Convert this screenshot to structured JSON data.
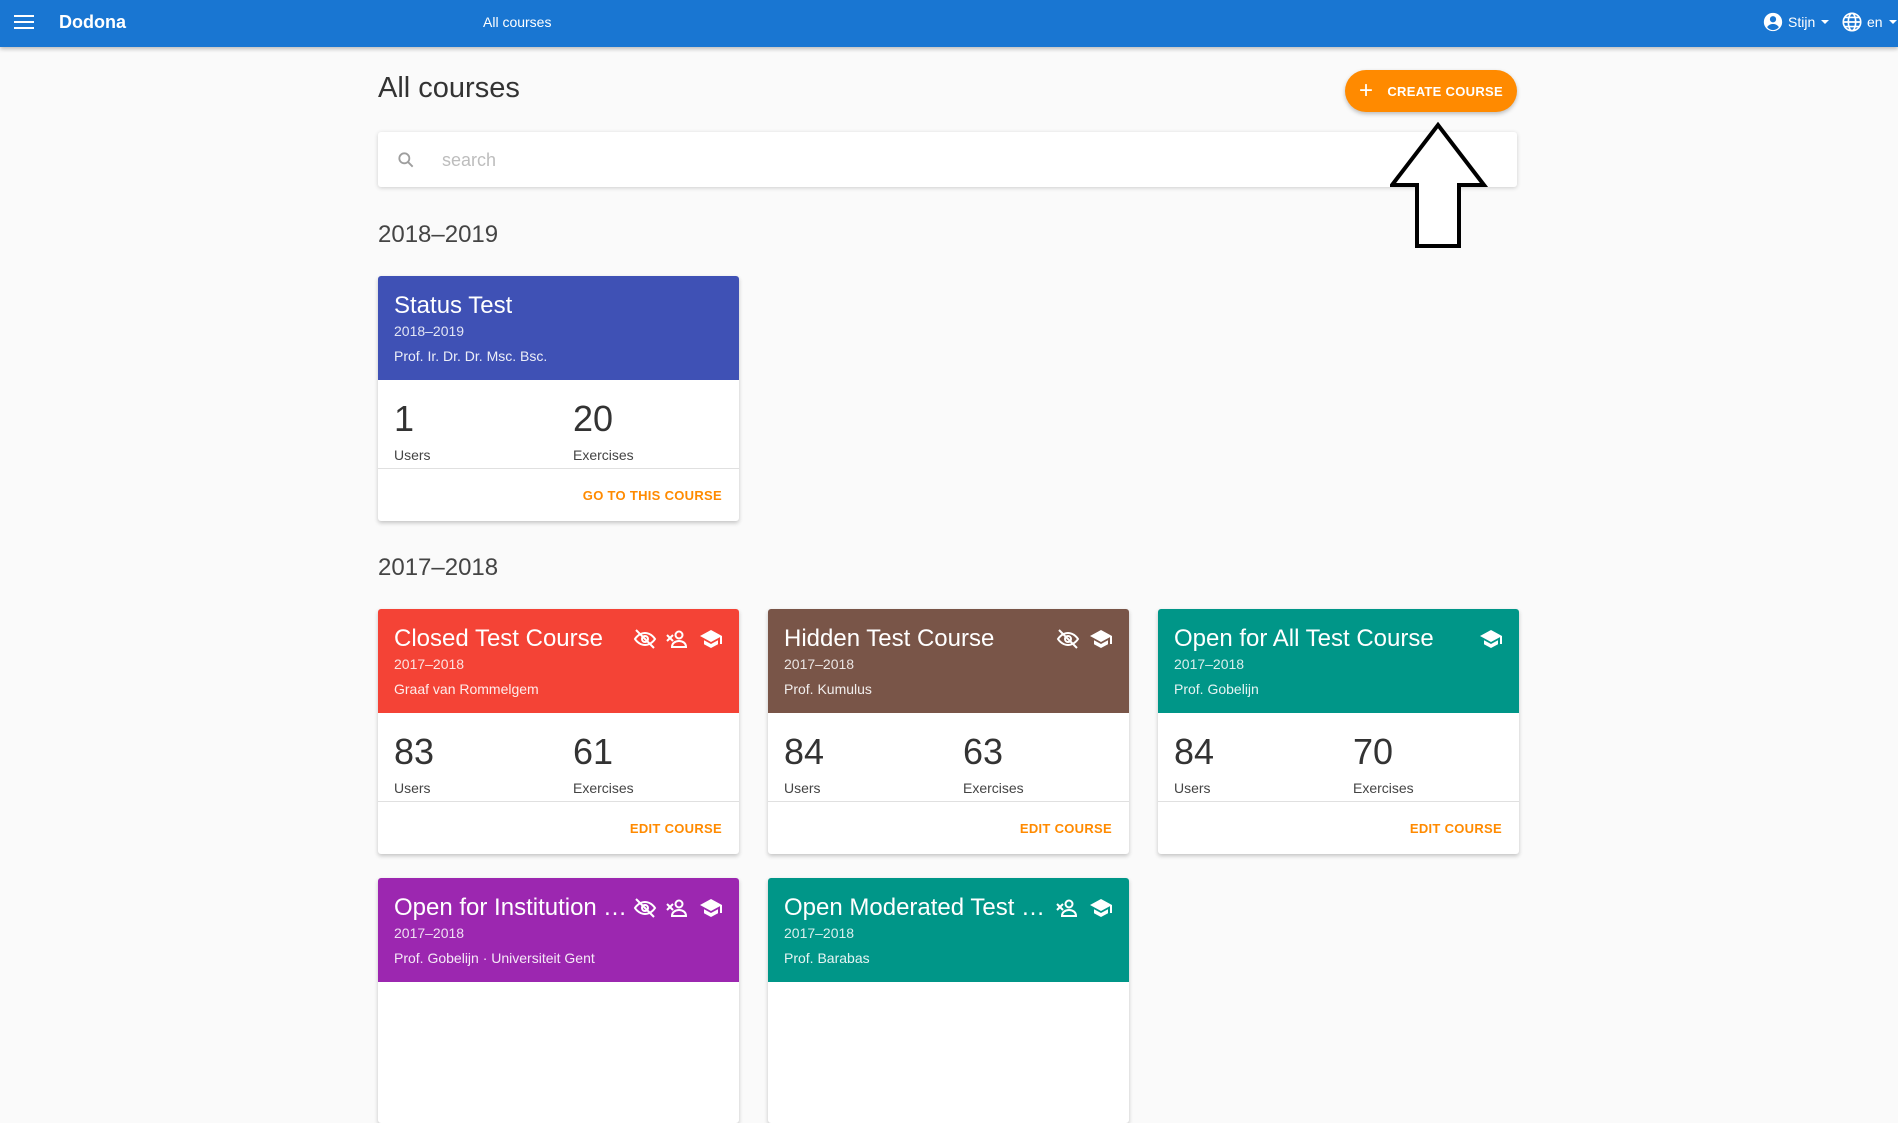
{
  "header": {
    "app_title": "Dodona",
    "breadcrumb": "All courses",
    "user_name": "Stijn",
    "language": "en",
    "color": "#1976d2"
  },
  "page": {
    "title": "All courses",
    "create_button_label": "CREATE COURSE",
    "search_placeholder": "search",
    "accent_color": "#ff8a00"
  },
  "sections": [
    {
      "year": "2018–2019",
      "courses": [
        {
          "name": "Status Test",
          "year": "2018–2019",
          "teacher": "Prof. Ir. Dr. Dr. Msc. Bsc.",
          "color": "#3f51b5",
          "users": "1",
          "users_label": "Users",
          "exercises": "20",
          "exercises_label": "Exercises",
          "action": "GO TO THIS COURSE",
          "icons": []
        }
      ]
    },
    {
      "year": "2017–2018",
      "courses": [
        {
          "name": "Closed Test Course",
          "year": "2017–2018",
          "teacher": "Graaf van Rommelgem",
          "color": "#f44336",
          "users": "83",
          "users_label": "Users",
          "exercises": "61",
          "exercises_label": "Exercises",
          "action": "EDIT COURSE",
          "icons": [
            "eye-off-icon",
            "person-remove-icon",
            "graduation-cap-icon"
          ]
        },
        {
          "name": "Hidden Test Course",
          "year": "2017–2018",
          "teacher": "Prof. Kumulus",
          "color": "#795548",
          "users": "84",
          "users_label": "Users",
          "exercises": "63",
          "exercises_label": "Exercises",
          "action": "EDIT COURSE",
          "icons": [
            "eye-off-icon",
            "graduation-cap-icon"
          ]
        },
        {
          "name": "Open for All Test Course",
          "year": "2017–2018",
          "teacher": "Prof. Gobelijn",
          "color": "#009688",
          "users": "84",
          "users_label": "Users",
          "exercises": "70",
          "exercises_label": "Exercises",
          "action": "EDIT COURSE",
          "icons": [
            "graduation-cap-icon"
          ]
        },
        {
          "name": "Open for Institution T...",
          "year": "2017–2018",
          "teacher": "Prof. Gobelijn · Universiteit Gent",
          "color": "#9c27b0",
          "icons": [
            "eye-off-icon",
            "person-remove-icon",
            "graduation-cap-icon"
          ]
        },
        {
          "name": "Open Moderated Test C...",
          "year": "2017–2018",
          "teacher": "Prof. Barabas",
          "color": "#009688",
          "icons": [
            "person-remove-icon",
            "graduation-cap-icon"
          ]
        }
      ]
    }
  ]
}
